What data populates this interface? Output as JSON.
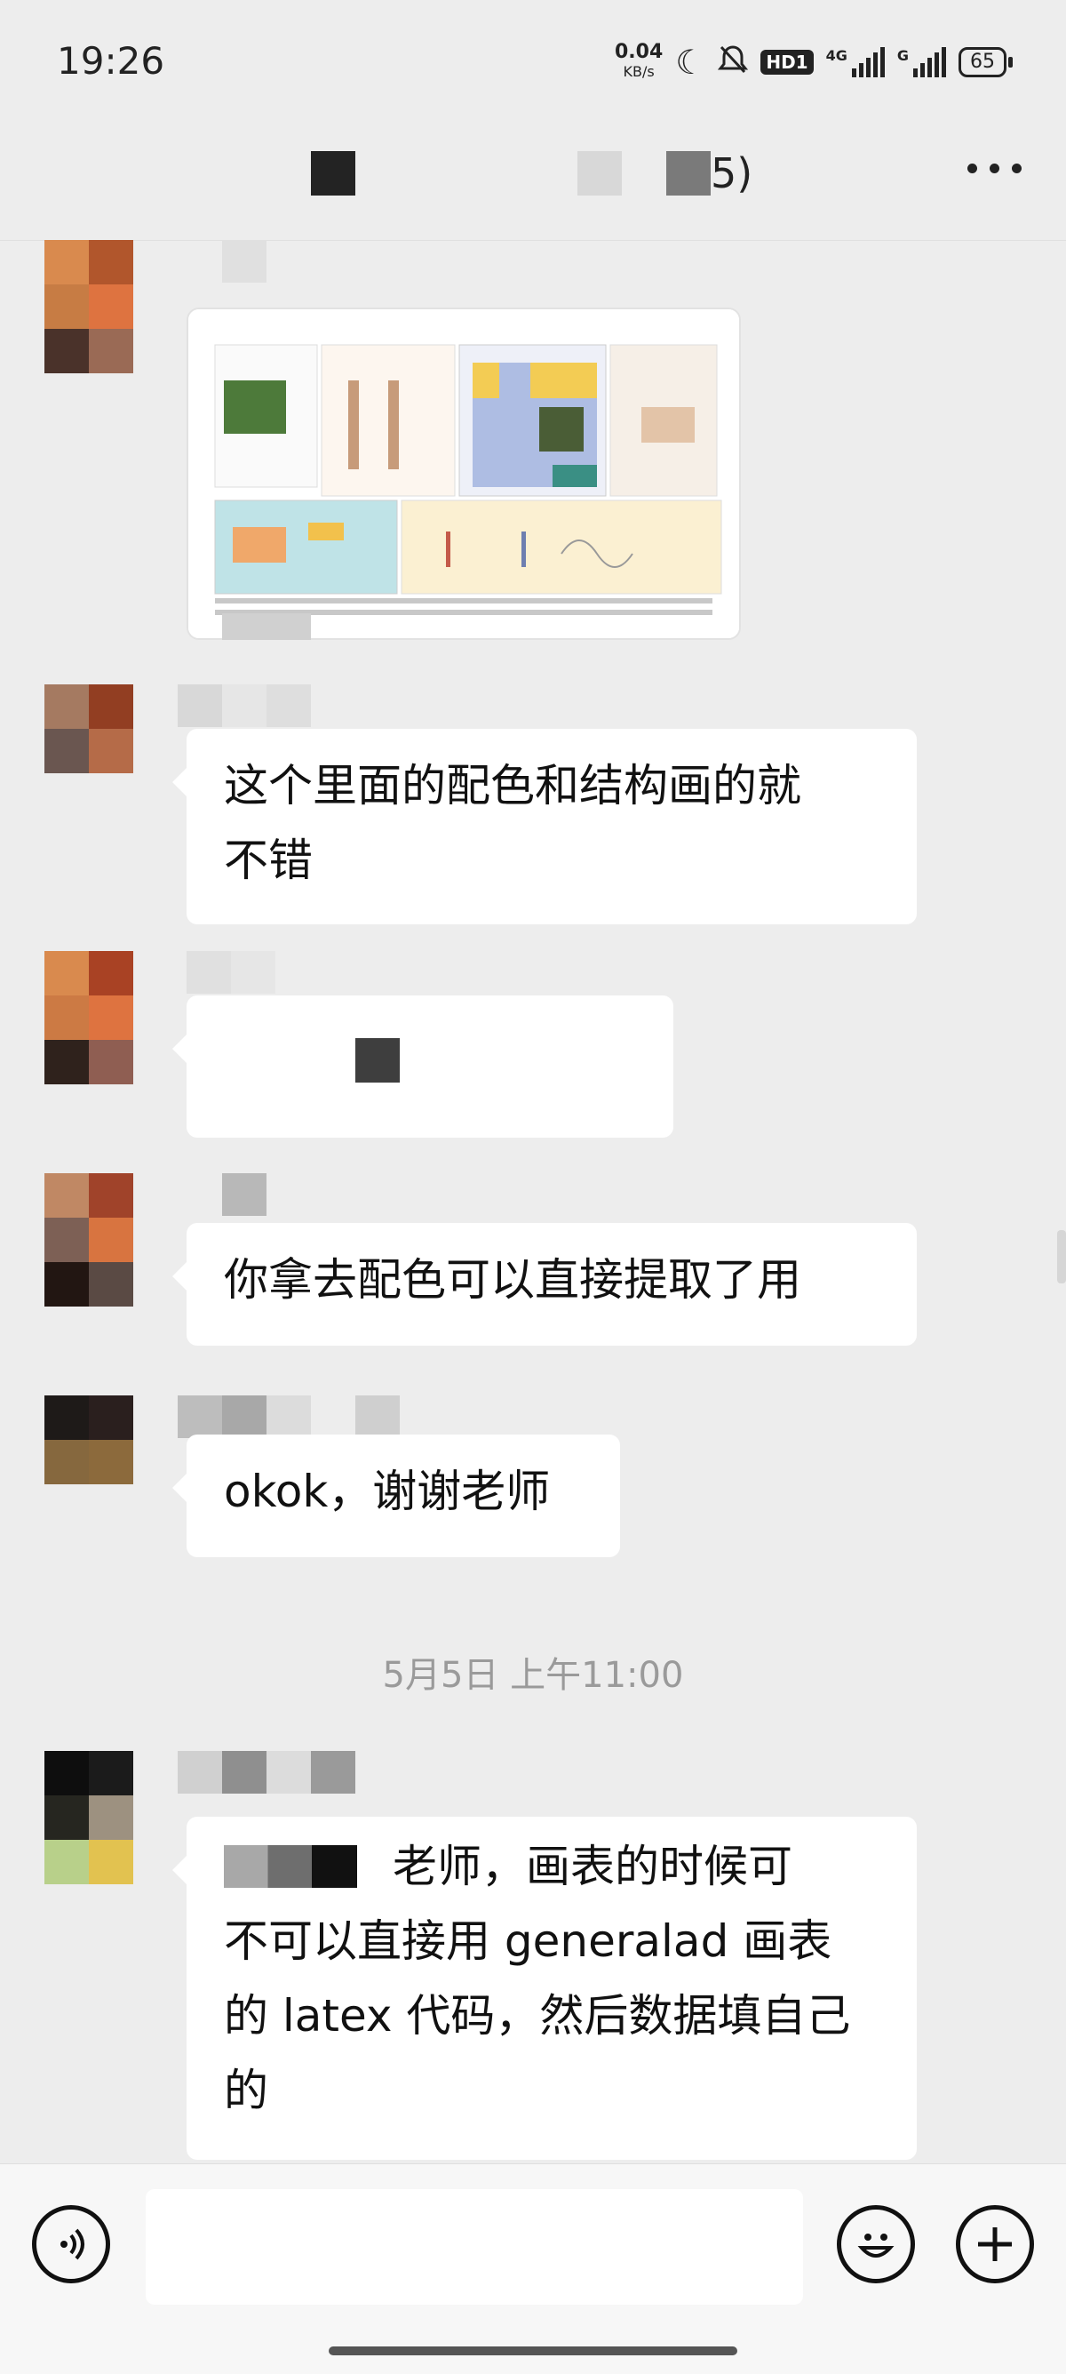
{
  "status_bar": {
    "time": "19:26",
    "net_speed": "0.04",
    "net_unit": "KB/s",
    "hd_label": "HD1",
    "signal1_label": "4G",
    "signal2_label": "G",
    "battery": "65",
    "icons": [
      "moon-icon",
      "mute-bell-icon",
      "signal-icon",
      "battery-icon"
    ]
  },
  "chat_header": {
    "title_suffix": "5)",
    "more_icon": "more-dots-icon"
  },
  "messages": [
    {
      "type": "image",
      "caption": ""
    },
    {
      "type": "text",
      "lines": [
        "这个里面的配色和结构画的就",
        "不错"
      ]
    },
    {
      "type": "redacted",
      "text": ""
    },
    {
      "type": "text",
      "lines": [
        "你拿去配色可以直接提取了用"
      ]
    },
    {
      "type": "text",
      "lines": [
        "okok，谢谢老师"
      ]
    },
    {
      "type": "text",
      "lines": [
        "老师，画表的时候可",
        "不可以直接用 generalad 画表",
        "的 latex 代码，然后数据填自己",
        "的"
      ]
    }
  ],
  "timestamp": "5月5日 上午11:00",
  "input_bar": {
    "voice_icon": "voice-icon",
    "emoji_icon": "emoji-icon",
    "add_icon": "plus-icon",
    "input_value": ""
  },
  "colors": {
    "background": "#ededed",
    "bubble": "#ffffff",
    "timestamp_text": "#9a9a9a"
  }
}
